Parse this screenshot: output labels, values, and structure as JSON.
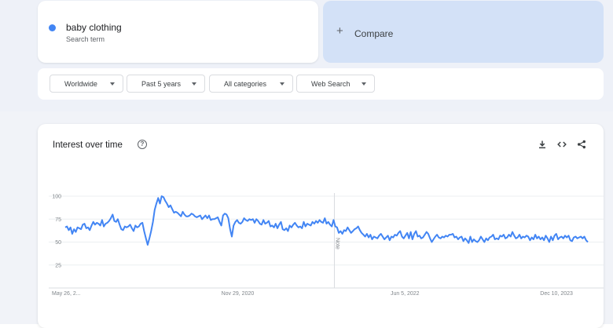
{
  "search_term": {
    "name": "baby clothing",
    "subtitle": "Search term",
    "color": "#4285f4"
  },
  "compare": {
    "plus": "+",
    "label": "Compare"
  },
  "filters": [
    {
      "label": "Worldwide"
    },
    {
      "label": "Past 5 years"
    },
    {
      "label": "All categories"
    },
    {
      "label": "Web Search"
    }
  ],
  "panel": {
    "title": "Interest over time",
    "icons": [
      "help-icon",
      "download-icon",
      "embed-icon",
      "share-icon"
    ]
  },
  "chart_data": {
    "type": "line",
    "title": "Interest over time",
    "ylim": [
      0,
      100
    ],
    "y_ticks": [
      "100",
      "75",
      "50",
      "25"
    ],
    "x_tick_labels": [
      "May 26, 2...",
      "Nov 29, 2020",
      "Jun 5, 2022",
      "Dec 10, 2023"
    ],
    "note_label": "Note",
    "grid": true,
    "series": [
      {
        "name": "baby clothing",
        "color": "#4285f4",
        "values": [
          66,
          67,
          63,
          66,
          59,
          64,
          61,
          66,
          65,
          64,
          69,
          70,
          65,
          66,
          63,
          68,
          72,
          69,
          71,
          70,
          68,
          74,
          67,
          70,
          71,
          73,
          76,
          80,
          73,
          72,
          75,
          69,
          64,
          63,
          67,
          66,
          67,
          69,
          65,
          62,
          68,
          66,
          67,
          70,
          71,
          62,
          54,
          47,
          54,
          62,
          72,
          85,
          92,
          98,
          92,
          100,
          99,
          95,
          92,
          88,
          90,
          86,
          82,
          83,
          82,
          80,
          78,
          83,
          80,
          78,
          78,
          79,
          81,
          80,
          78,
          77,
          78,
          79,
          75,
          77,
          79,
          76,
          79,
          74,
          75,
          75,
          76,
          77,
          72,
          68,
          79,
          81,
          80,
          76,
          64,
          56,
          68,
          72,
          74,
          71,
          70,
          72,
          76,
          74,
          73,
          75,
          74,
          75,
          71,
          75,
          73,
          70,
          69,
          74,
          70,
          71,
          73,
          67,
          68,
          66,
          70,
          65,
          69,
          72,
          64,
          63,
          65,
          62,
          68,
          66,
          69,
          71,
          68,
          66,
          67,
          65,
          72,
          67,
          70,
          69,
          68,
          72,
          70,
          73,
          71,
          74,
          72,
          71,
          76,
          70,
          72,
          69,
          67,
          74,
          67,
          66,
          60,
          62,
          59,
          63,
          62,
          66,
          63,
          60,
          62,
          64,
          65,
          67,
          63,
          60,
          58,
          56,
          59,
          55,
          58,
          53,
          56,
          55,
          54,
          57,
          59,
          56,
          53,
          55,
          57,
          52,
          56,
          55,
          58,
          57,
          60,
          62,
          56,
          54,
          57,
          60,
          54,
          61,
          53,
          59,
          62,
          56,
          57,
          54,
          55,
          58,
          61,
          59,
          54,
          50,
          53,
          56,
          58,
          55,
          54,
          56,
          55,
          57,
          56,
          58,
          58,
          59,
          55,
          56,
          53,
          55,
          56,
          51,
          54,
          52,
          49,
          56,
          50,
          53,
          51,
          50,
          52,
          56,
          53,
          50,
          54,
          52,
          55,
          56,
          58,
          53,
          54,
          53,
          57,
          56,
          58,
          54,
          55,
          58,
          56,
          61,
          57,
          54,
          55,
          58,
          54,
          56,
          55,
          57,
          56,
          52,
          55,
          53,
          58,
          54,
          56,
          53,
          55,
          52,
          57,
          54,
          50,
          56,
          52,
          57,
          59,
          53,
          55,
          56,
          54,
          57,
          55,
          57,
          52,
          51,
          55,
          56,
          54,
          55,
          56,
          54,
          56,
          52,
          50
        ]
      }
    ]
  }
}
